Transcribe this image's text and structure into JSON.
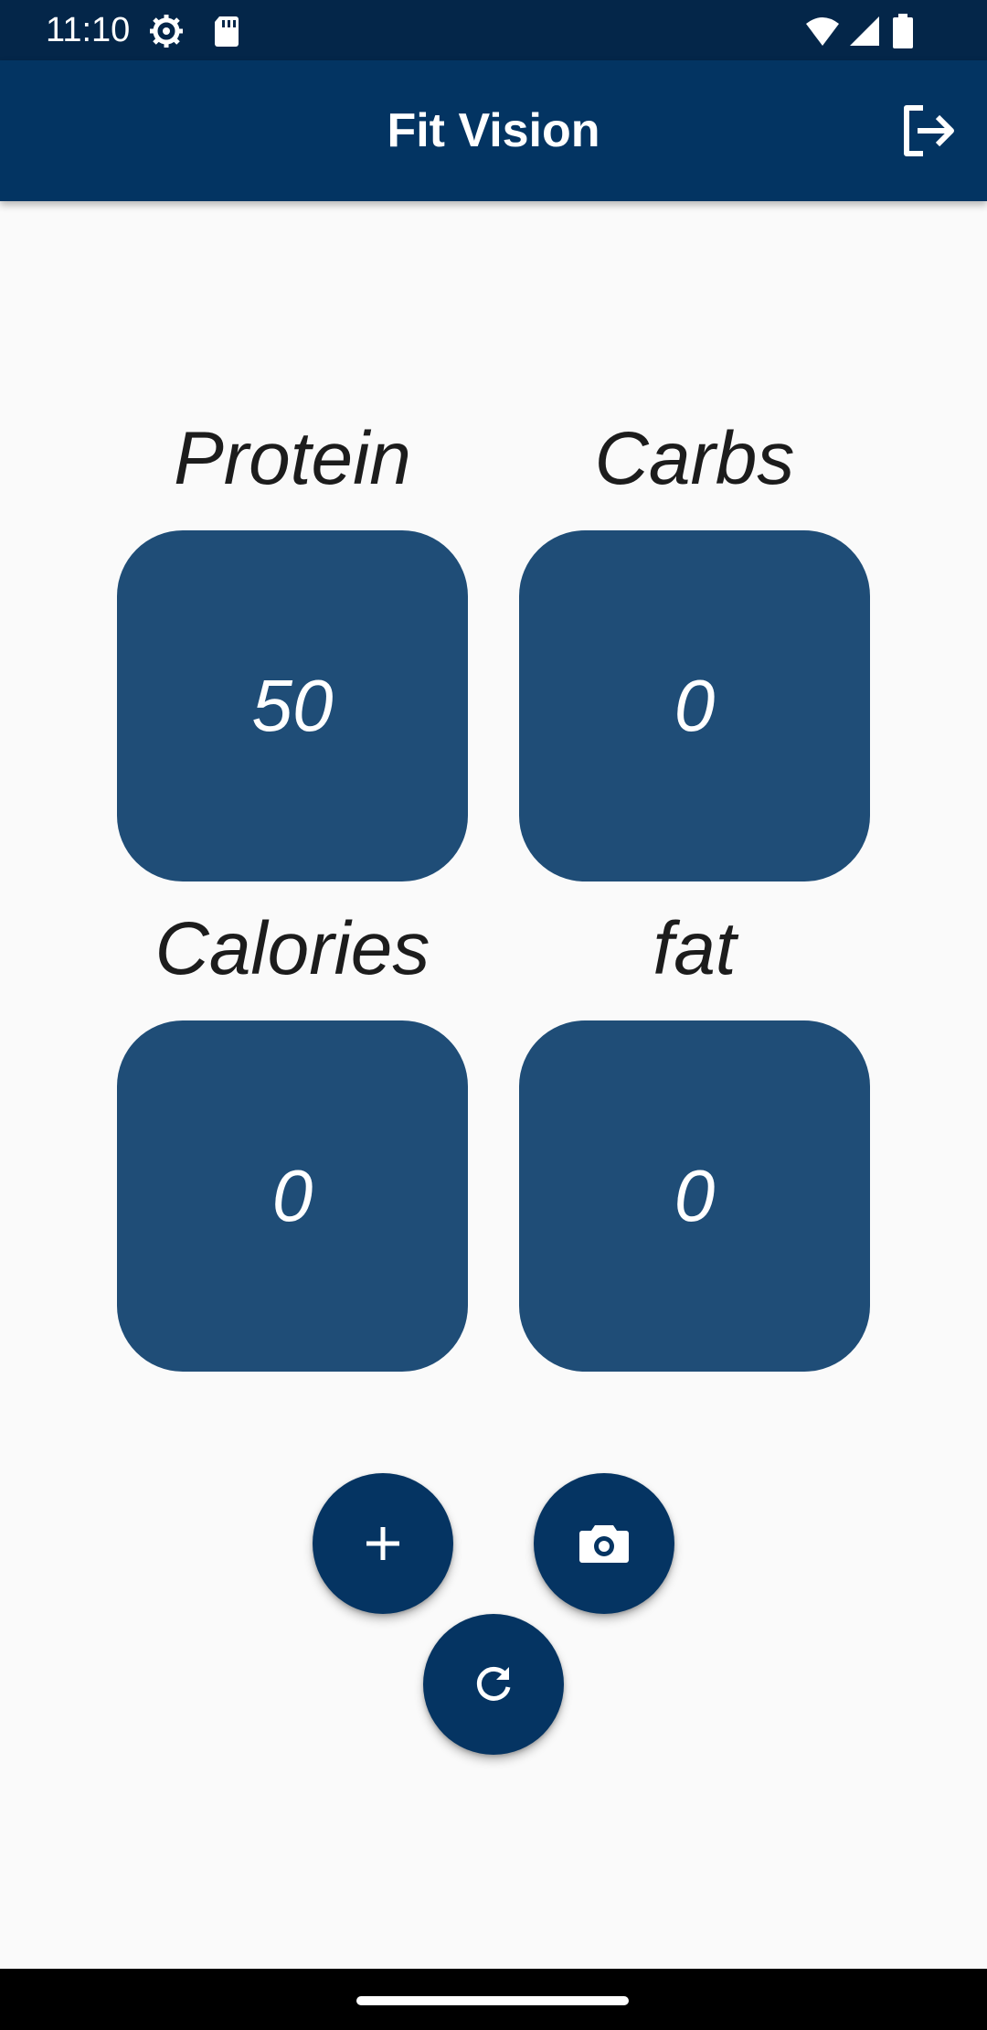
{
  "status_bar": {
    "time": "11:10",
    "icons": [
      "settings-gear-icon",
      "sd-card-icon",
      "wifi-icon",
      "signal-icon",
      "battery-icon"
    ]
  },
  "app_bar": {
    "title": "Fit Vision",
    "logout_icon": "logout-icon"
  },
  "stats": {
    "protein": {
      "label": "Protein",
      "value": "50"
    },
    "carbs": {
      "label": "Carbs",
      "value": "0"
    },
    "calories": {
      "label": "Calories",
      "value": "0"
    },
    "fat": {
      "label": "fat",
      "value": "0"
    }
  },
  "actions": {
    "add_icon": "plus-icon",
    "camera_icon": "camera-icon",
    "refresh_icon": "refresh-icon"
  },
  "colors": {
    "status_bar": "#042649",
    "app_bar": "#033462",
    "stat_box": "#1f4d77",
    "fab": "#053462",
    "background": "#fafafa"
  }
}
